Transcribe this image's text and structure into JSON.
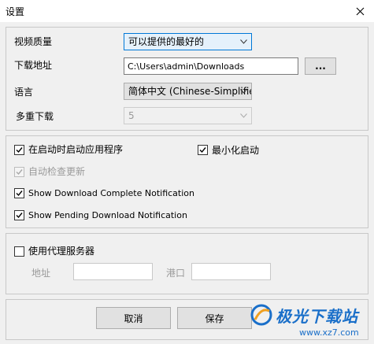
{
  "window": {
    "title": "设置",
    "close_icon": "close-icon"
  },
  "general": {
    "video_quality": {
      "label": "视频质量",
      "value": "可以提供的最好的"
    },
    "download_path": {
      "label": "下载地址",
      "value": "C:\\Users\\admin\\Downloads",
      "browse_label": "..."
    },
    "language": {
      "label": "语言",
      "value": "简体中文 (Chinese-Simplified)"
    },
    "multi_download": {
      "label": "多重下载",
      "value": "5"
    }
  },
  "startup": {
    "launch_on_startup": {
      "label": "在启动时启动应用程序",
      "checked": true
    },
    "start_minimized": {
      "label": "最小化启动",
      "checked": true
    },
    "auto_check_update": {
      "label": "自动检查更新",
      "checked": true,
      "disabled": true
    },
    "show_complete": {
      "label": "Show Download Complete Notification",
      "checked": true
    },
    "show_pending": {
      "label": "Show Pending Download Notification",
      "checked": true
    }
  },
  "proxy": {
    "use_proxy": {
      "label": "使用代理服务器",
      "checked": false
    },
    "address_label": "地址",
    "address_value": "",
    "port_label": "港口",
    "port_value": ""
  },
  "footer": {
    "cancel_label": "取消",
    "save_label": "保存"
  },
  "watermark": {
    "brand": "极光下载站",
    "url": "www.xz7.com"
  }
}
